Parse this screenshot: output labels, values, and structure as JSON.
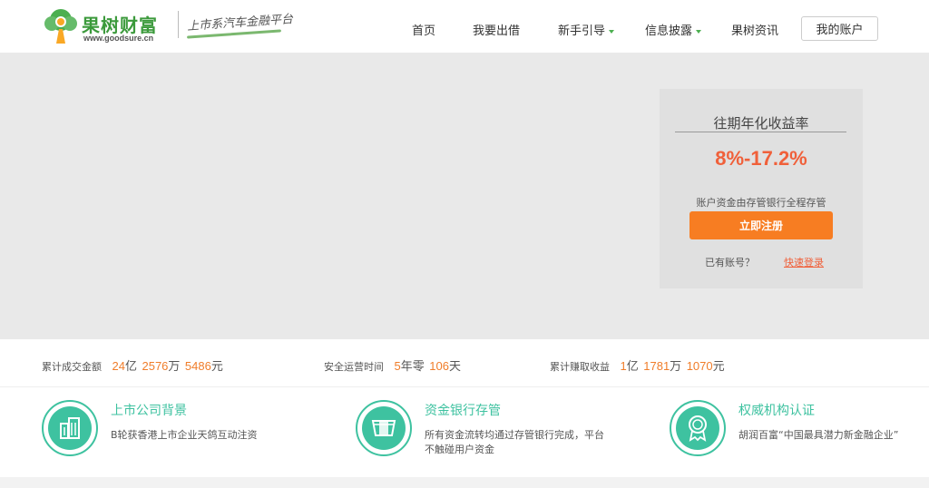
{
  "header": {
    "logo_name": "果树财富",
    "logo_url": "www.goodsure.cn",
    "slogan": "上市系汽车金融平台",
    "nav": [
      {
        "label": "首页",
        "has_caret": false
      },
      {
        "label": "我要出借",
        "has_caret": false
      },
      {
        "label": "新手引导",
        "has_caret": true
      },
      {
        "label": "信息披露",
        "has_caret": true
      },
      {
        "label": "果树资讯",
        "has_caret": false
      }
    ],
    "account_label": "我的账户"
  },
  "panel": {
    "title": "往期年化收益率",
    "rate": "8%-17.2%",
    "note": "账户资金由存管银行全程存管",
    "register_label": "立即注册",
    "have_account": "已有账号？",
    "login_label": "快速登录"
  },
  "stats": [
    {
      "label": "累计成交金额",
      "parts": [
        [
          "24",
          "亿"
        ],
        [
          "2576",
          "万"
        ],
        [
          "5486",
          "元"
        ]
      ]
    },
    {
      "label": "安全运营时间",
      "parts": [
        [
          "5",
          "年零"
        ],
        [
          "106",
          "天"
        ]
      ]
    },
    {
      "label": "累计赚取收益",
      "parts": [
        [
          "1",
          "亿"
        ],
        [
          "1781",
          "万"
        ],
        [
          "1070",
          "元"
        ]
      ]
    }
  ],
  "features": [
    {
      "title": "上市公司背景",
      "desc": "B轮获香港上市企业天鸽互动注资",
      "icon": "building-icon"
    },
    {
      "title": "资金银行存管",
      "desc": "所有资金流转均通过存管银行完成，平台不触碰用户资金",
      "icon": "bank-card-icon"
    },
    {
      "title": "权威机构认证",
      "desc": "胡润百富“中国最具潜力新金融企业”",
      "icon": "award-badge-icon"
    }
  ],
  "colors": {
    "brand_green": "#3c9a3c",
    "accent_orange": "#f77d22",
    "rate_red": "#f0603a",
    "feature_teal": "#3ec2a0",
    "banner_bg": "#e9e9e9"
  }
}
